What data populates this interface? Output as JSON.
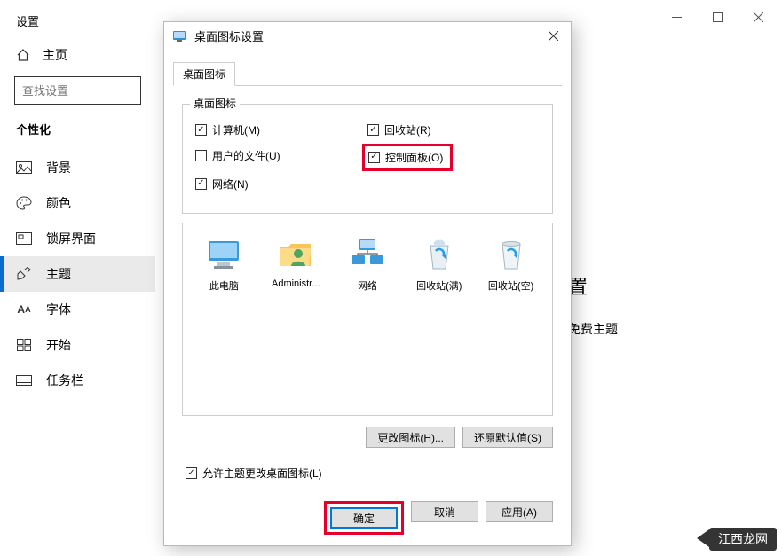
{
  "settings": {
    "title": "设置",
    "home": "主页",
    "search_placeholder": "查找设置",
    "section": "个性化",
    "nav": [
      {
        "label": "背景"
      },
      {
        "label": "颜色"
      },
      {
        "label": "锁屏界面"
      },
      {
        "label": "主题"
      },
      {
        "label": "字体"
      },
      {
        "label": "开始"
      },
      {
        "label": "任务栏"
      }
    ],
    "right_header_tail": "置",
    "right_line_tail": "免费主题"
  },
  "dialog": {
    "title": "桌面图标设置",
    "tab": "桌面图标",
    "group_legend": "桌面图标",
    "checks": {
      "computer": {
        "label": "计算机(M)",
        "checked": true
      },
      "recycle": {
        "label": "回收站(R)",
        "checked": true
      },
      "userfiles": {
        "label": "用户的文件(U)",
        "checked": false
      },
      "control": {
        "label": "控制面板(O)",
        "checked": true
      },
      "network": {
        "label": "网络(N)",
        "checked": true
      }
    },
    "icons": [
      {
        "name": "此电脑"
      },
      {
        "name": "Administr..."
      },
      {
        "name": "网络"
      },
      {
        "name": "回收站(满)"
      },
      {
        "name": "回收站(空)"
      }
    ],
    "change_icon": "更改图标(H)...",
    "restore_default": "还原默认值(S)",
    "allow_themes": "允许主题更改桌面图标(L)",
    "allow_themes_checked": true,
    "ok": "确定",
    "cancel": "取消",
    "apply": "应用(A)"
  },
  "watermark": "江西龙网"
}
